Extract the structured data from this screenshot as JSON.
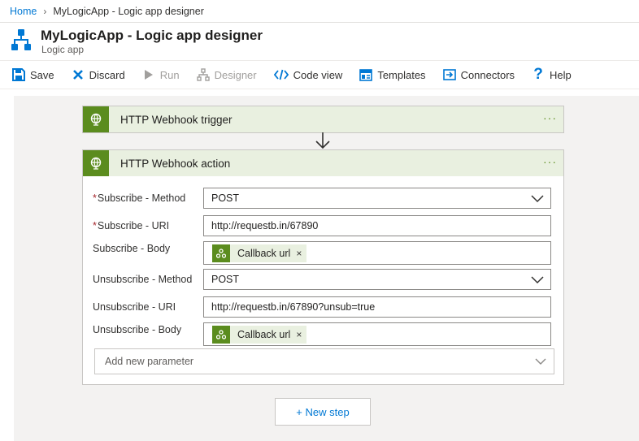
{
  "breadcrumb": {
    "home": "Home",
    "current": "MyLogicApp - Logic app designer"
  },
  "header": {
    "title": "MyLogicApp - Logic app designer",
    "subtitle": "Logic app"
  },
  "toolbar": {
    "save": "Save",
    "discard": "Discard",
    "run": "Run",
    "designer": "Designer",
    "code_view": "Code view",
    "templates": "Templates",
    "connectors": "Connectors",
    "help": "Help"
  },
  "trigger": {
    "title": "HTTP Webhook trigger",
    "more": "···"
  },
  "action": {
    "title": "HTTP Webhook action",
    "more": "···",
    "params": [
      {
        "label": "Subscribe - Method",
        "required": true,
        "value": "POST",
        "type": "dropdown"
      },
      {
        "label": "Subscribe - URI",
        "required": true,
        "value": "http://requestb.in/67890",
        "type": "text"
      },
      {
        "label": "Subscribe - Body",
        "required": false,
        "value": "Callback url",
        "type": "token"
      },
      {
        "label": "Unsubscribe - Method",
        "required": false,
        "value": "POST",
        "type": "dropdown"
      },
      {
        "label": "Unsubscribe - URI",
        "required": false,
        "value": "http://requestb.in/67890?unsub=true",
        "type": "text"
      },
      {
        "label": "Unsubscribe - Body",
        "required": false,
        "value": "Callback url",
        "type": "token"
      }
    ],
    "add_param": "Add new parameter",
    "required_mark": "*",
    "token_close": "×"
  },
  "new_step": "+ New step",
  "colors": {
    "accent": "#0078d4",
    "connector_green": "#5b8c1e",
    "card_header": "#e9f0e0",
    "canvas": "#f3f2f1"
  },
  "icons": [
    "logic-app-icon",
    "save-icon",
    "discard-icon",
    "run-icon",
    "designer-icon",
    "code-view-icon",
    "templates-icon",
    "connectors-icon",
    "help-icon",
    "webhook-icon",
    "chevron-down-icon",
    "arrow-down-icon"
  ]
}
